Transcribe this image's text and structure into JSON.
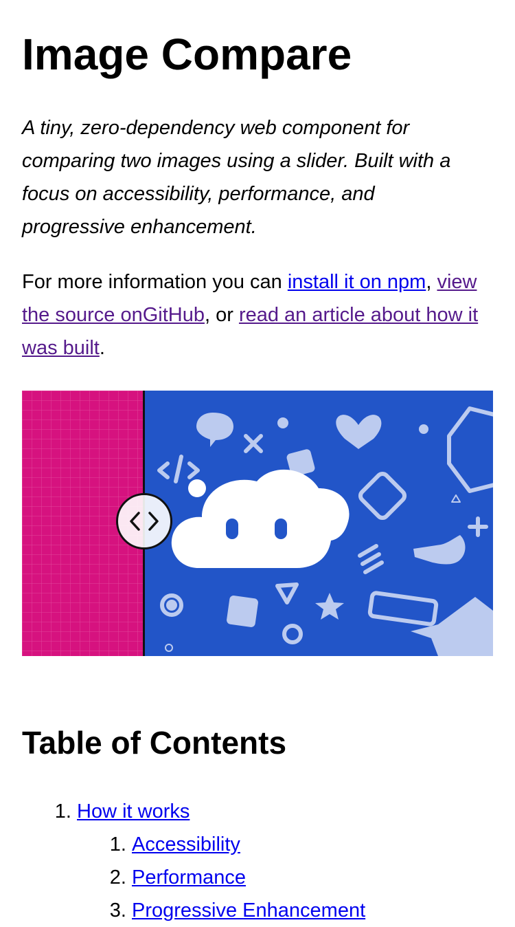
{
  "title": "Image Compare",
  "lead": "A tiny, zero-dependency web component for comparing two images using a slider. Built with a focus on accessibility, performance, and progressive enhancement.",
  "info": {
    "prefix": "For more information you can ",
    "link_npm": "install it on npm",
    "comma": ", ",
    "link_github": "view the source onGitHub",
    "or": ", or ",
    "link_article": "read an article about how it was built",
    "period": "."
  },
  "compare": {
    "slider_position": 0.26,
    "left_color": "#d6127f",
    "right_color": "#2255c8",
    "handle_icon": "chevrons-left-right-icon"
  },
  "toc": {
    "heading": "Table of Contents",
    "items": [
      {
        "label": "How it works",
        "children": [
          "Accessibility",
          "Performance",
          "Progressive Enhancement"
        ]
      }
    ]
  }
}
